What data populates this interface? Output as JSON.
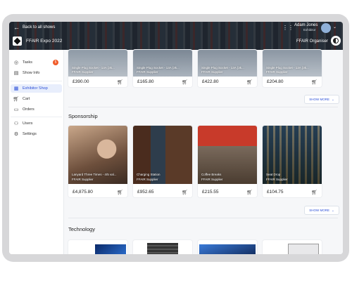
{
  "topbar": {
    "back_label": "Back to all shows",
    "event_name": "FFAIR Expo 2022",
    "user_name": "Adam Jones",
    "user_role": "Exhibitor",
    "organiser_label": "FFAIR Organiser"
  },
  "sidebar": {
    "items": [
      {
        "label": "Tasks",
        "icon": "check-circle-icon",
        "badge": "5"
      },
      {
        "label": "Show Info",
        "icon": "info-card-icon"
      },
      {
        "label": "Exhibitor Shop",
        "icon": "shop-icon",
        "active": true
      },
      {
        "label": "Cart",
        "icon": "cart-icon"
      },
      {
        "label": "Orders",
        "icon": "orders-icon"
      },
      {
        "label": "Users",
        "icon": "users-icon"
      },
      {
        "label": "Settings",
        "icon": "gear-icon"
      }
    ]
  },
  "main": {
    "power_products": [
      {
        "name": "Single Plug Socket - 13A (3k...",
        "supplier": "FFAIR Supplier",
        "price": "£390.00"
      },
      {
        "name": "Single Plug Socket - 13A (3k...",
        "supplier": "FFAIR Supplier",
        "price": "£165.80"
      },
      {
        "name": "Single Plug Socket - 13A (3k...",
        "supplier": "FFAIR Supplier",
        "price": "£422.80"
      },
      {
        "name": "Single Plug Socket - 13A (3k...",
        "supplier": "FFAIR Supplier",
        "price": "£204.80"
      }
    ],
    "show_more_label": "SHOW MORE",
    "sponsorship_title": "Sponsorship",
    "sponsorship_products": [
      {
        "name": "Lanyard Three Times - 4/5 val...",
        "supplier": "FFAIR Supplier",
        "price": "£4,875.80"
      },
      {
        "name": "Charging Station",
        "supplier": "FFAIR Supplier",
        "price": "£952.65"
      },
      {
        "name": "Coffee Breaks",
        "supplier": "FFAIR Supplier",
        "price": "£215.55"
      },
      {
        "name": "Seat Drop",
        "supplier": "FFAIR Supplier",
        "price": "£104.75"
      }
    ],
    "technology_title": "Technology"
  }
}
